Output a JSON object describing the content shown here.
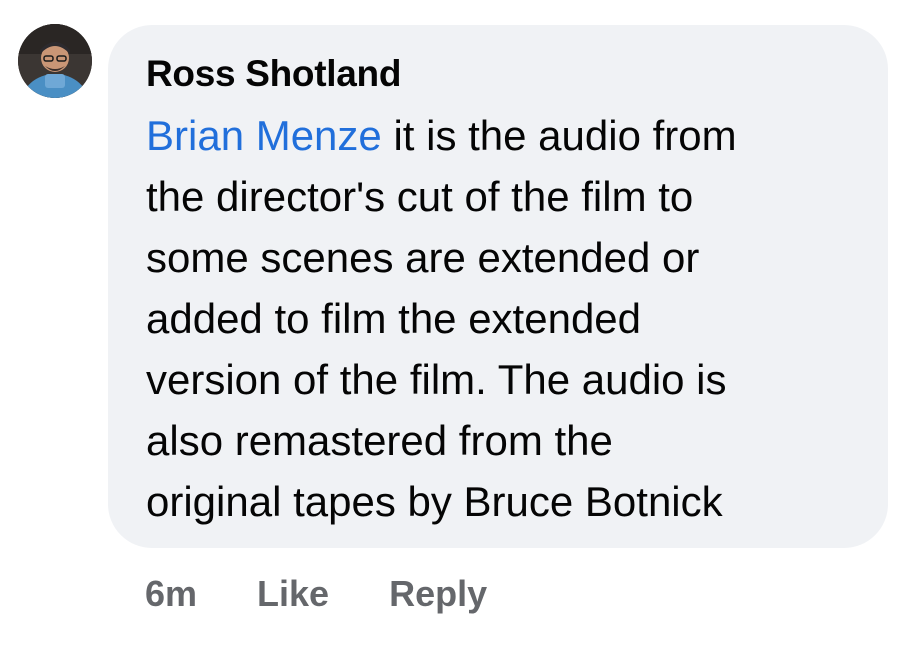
{
  "comment": {
    "author": "Ross Shotland",
    "mention": "Brian Menze",
    "lines": [
      " it is the audio from",
      "the director's cut of the film to",
      "some scenes are extended or",
      "added to film the extended",
      "version of the film. The audio is",
      "also remastered from the",
      "original tapes by Bruce Botnick"
    ]
  },
  "actions": {
    "timestamp": "6m",
    "like_label": "Like",
    "reply_label": "Reply"
  },
  "colors": {
    "mention": "#216fdb",
    "bubble_bg": "#f0f2f5",
    "action_text": "#65676b",
    "body_text": "#050505"
  },
  "icons": {
    "avatar": "profile-photo"
  }
}
